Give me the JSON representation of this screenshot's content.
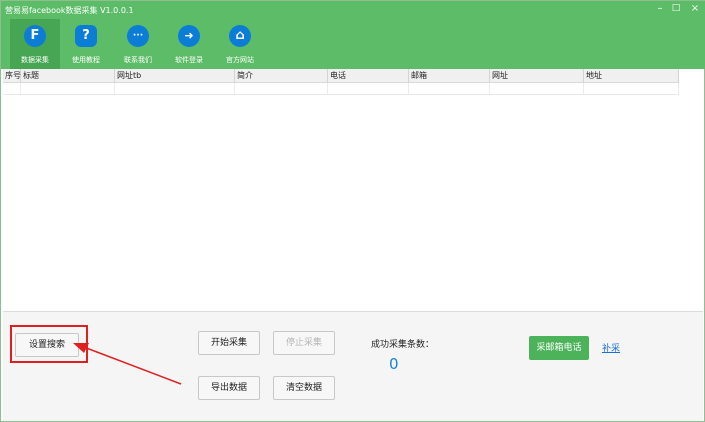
{
  "window": {
    "title": "营易易facebook数据采集 V1.0.0.1",
    "minimize": "–",
    "maximize": "□",
    "close": "×"
  },
  "toolbar": {
    "items": [
      {
        "label": "数据采集",
        "icon": "F",
        "icon_name": "facebook-icon"
      },
      {
        "label": "使用教程",
        "icon": "?",
        "icon_name": "help-icon"
      },
      {
        "label": "联系我们",
        "icon": "···",
        "icon_name": "chat-icon"
      },
      {
        "label": "软件登录",
        "icon": "➜",
        "icon_name": "login-arrow-icon"
      },
      {
        "label": "官方网站",
        "icon": "⌂",
        "icon_name": "home-icon"
      }
    ]
  },
  "table": {
    "columns": [
      "序号",
      "标题",
      "网址tb",
      "简介",
      "电话",
      "邮箱",
      "网址",
      "地址"
    ]
  },
  "bottom": {
    "settings_button": "设置搜索",
    "start_button": "开始采集",
    "stop_button": "停止采集",
    "export_button": "导出数据",
    "clear_button": "清空数据",
    "success_label": "成功采集条数：",
    "success_count": "0",
    "email_phone_button": "采邮箱电话",
    "supplement_link": "补采"
  },
  "colors": {
    "brand_green": "#5cbc68",
    "icon_blue": "#0b7dd6",
    "annotation_red": "#e02020"
  }
}
